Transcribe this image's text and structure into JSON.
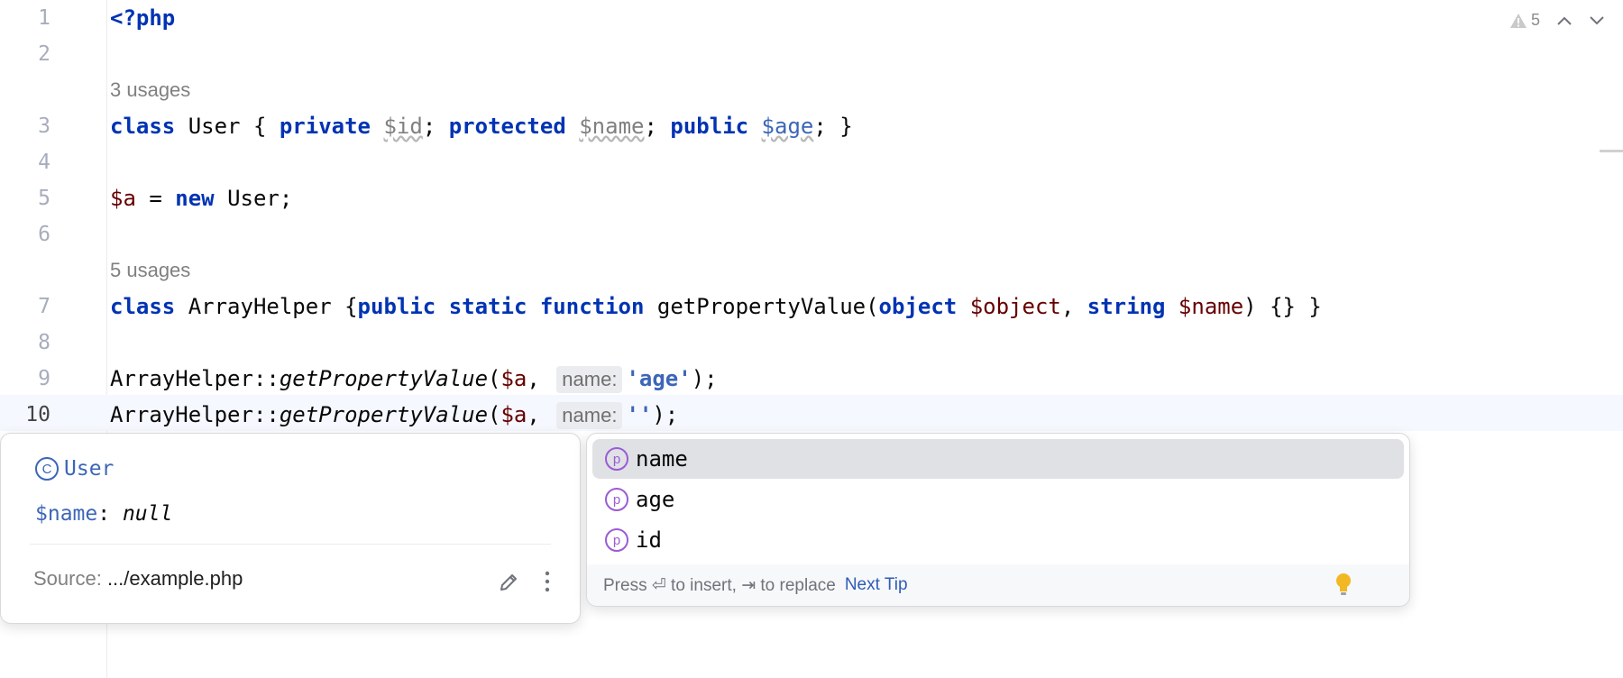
{
  "editor": {
    "line_numbers": [
      "1",
      "2",
      "3",
      "4",
      "5",
      "6",
      "7",
      "8",
      "9",
      "10"
    ],
    "usages": [
      "3 usages",
      "5 usages"
    ],
    "lines": {
      "l1": {
        "open": "<?php"
      },
      "l3": {
        "kw_class": "class",
        "name": "User",
        "brace_open": " { ",
        "kw_private": "private",
        "id": "$id",
        "semi1": "; ",
        "kw_protected": "protected",
        "name_var": "$name",
        "semi2": "; ",
        "kw_public": "public",
        "age": "$age",
        "end": "; }"
      },
      "l5": {
        "var": "$a",
        "eq": " = ",
        "kw_new": "new",
        "rest": " User;"
      },
      "l7": {
        "kw_class": "class",
        "name": " ArrayHelper {",
        "kw_public": "public",
        "kw_static": "static",
        "kw_function": "function",
        "fn": " getPropertyValue(",
        "kw_object": "object",
        "param1": "$object",
        "comma": ", ",
        "kw_string": "string",
        "param2": "$name",
        "end": ") {} }"
      },
      "l9": {
        "cls": "ArrayHelper::",
        "fn": "getPropertyValue",
        "open": "(",
        "var": "$a",
        "comma": ", ",
        "hint": "name:",
        "str": "'age'",
        "end": ");"
      },
      "l10": {
        "cls": "ArrayHelper::",
        "fn": "getPropertyValue",
        "open": "(",
        "var": "$a",
        "comma": ", ",
        "hint": "name:",
        "str": "''",
        "end": ");"
      }
    }
  },
  "top_right": {
    "warning_count": "5",
    "warn_icon": "warning-icon",
    "up_icon": "chevron-up-icon",
    "down_icon": "chevron-down-icon"
  },
  "doc_popup": {
    "class_label": "User",
    "class_icon_letter": "C",
    "member_var": "$name",
    "member_sep": ": ",
    "member_value": "null",
    "source_label": "Source: ",
    "source_path": ".../example.php"
  },
  "completion": {
    "items": [
      {
        "label": "name",
        "icon_letter": "p",
        "selected": true
      },
      {
        "label": "age",
        "icon_letter": "p",
        "selected": false
      },
      {
        "label": "id",
        "icon_letter": "p",
        "selected": false
      }
    ],
    "footer_text": "Press ⏎ to insert, ⇥ to replace",
    "next_tip": "Next Tip"
  },
  "colors": {
    "keyword": "#0033b3",
    "variable": "#660000",
    "hint_bg": "#ebecf0",
    "selection": "#dfe1e5",
    "property_icon": "#9b5bd6"
  }
}
